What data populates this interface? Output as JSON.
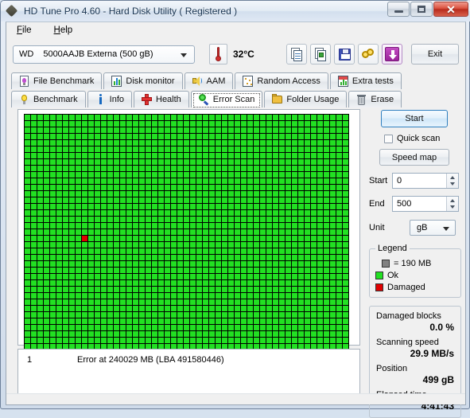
{
  "window": {
    "title": "HD Tune Pro 4.60 - Hard Disk Utility (  Registered )",
    "app_icon": "diamond-logo-icon",
    "minimize_label": "",
    "maximize_label": "",
    "close_label": "✕"
  },
  "menu": {
    "items": [
      {
        "label": "File",
        "mnemonic": "F"
      },
      {
        "label": "Help",
        "mnemonic": "H"
      }
    ]
  },
  "toolbar": {
    "device": {
      "brand": "WD",
      "model": "5000AAJB Externa (500 gB)"
    },
    "temperature": "32°C",
    "thermometer_icon": "thermometer-icon",
    "buttons": [
      {
        "name": "copy-text-button",
        "icon": "copy-document-icon"
      },
      {
        "name": "copy-image-button",
        "icon": "copy-image-icon"
      },
      {
        "name": "save-button",
        "icon": "floppy-disk-icon"
      },
      {
        "name": "gold-rings-button",
        "icon": "gold-rings-icon"
      },
      {
        "name": "download-button",
        "icon": "down-arrow-icon"
      }
    ],
    "exit_label": "Exit"
  },
  "tabs": {
    "row1": [
      {
        "label": "File Benchmark",
        "icon": "document-bulb-icon",
        "active": false
      },
      {
        "label": "Disk monitor",
        "icon": "bar-chart-icon",
        "active": false
      },
      {
        "label": "AAM",
        "icon": "speaker-icon",
        "active": false
      },
      {
        "label": "Random Access",
        "icon": "random-dots-icon",
        "active": false
      },
      {
        "label": "Extra tests",
        "icon": "extra-chart-icon",
        "active": false
      }
    ],
    "row2": [
      {
        "label": "Benchmark",
        "icon": "light-bulb-icon",
        "active": false
      },
      {
        "label": "Info",
        "icon": "info-icon",
        "active": false
      },
      {
        "label": "Health",
        "icon": "red-cross-icon",
        "active": false
      },
      {
        "label": "Error Scan",
        "icon": "magnifier-icon",
        "active": true
      },
      {
        "label": "Folder Usage",
        "icon": "folder-icon",
        "active": false
      },
      {
        "label": "Erase",
        "icon": "trash-icon",
        "active": false
      }
    ]
  },
  "scan_map": {
    "columns": 51,
    "rows": 37,
    "ok_color": "#22e022",
    "damaged_color": "#e00000",
    "grid_color": "#000000",
    "damaged_cells": [
      {
        "col": 9,
        "row": 19
      }
    ]
  },
  "log": {
    "rows": [
      {
        "index": "1",
        "message": "Error at 240029 MB (LBA 491580446)"
      }
    ]
  },
  "controls": {
    "start_label": "Start",
    "quick_scan_label": "Quick scan",
    "quick_scan_checked": false,
    "speed_map_label": "Speed map",
    "start_field": {
      "label": "Start",
      "value": "0"
    },
    "end_field": {
      "label": "End",
      "value": "500"
    },
    "unit_field": {
      "label": "Unit",
      "value": "gB"
    }
  },
  "legend": {
    "title": "Legend",
    "block_size": "= 190 MB",
    "ok_label": "Ok",
    "damaged_label": "Damaged"
  },
  "stats": {
    "damaged_blocks_label": "Damaged blocks",
    "damaged_blocks_value": "0.0 %",
    "scanning_speed_label": "Scanning speed",
    "scanning_speed_value": "29.9 MB/s",
    "position_label": "Position",
    "position_value": "499 gB",
    "elapsed_time_label": "Elapsed time",
    "elapsed_time_value": "4:41:43"
  }
}
